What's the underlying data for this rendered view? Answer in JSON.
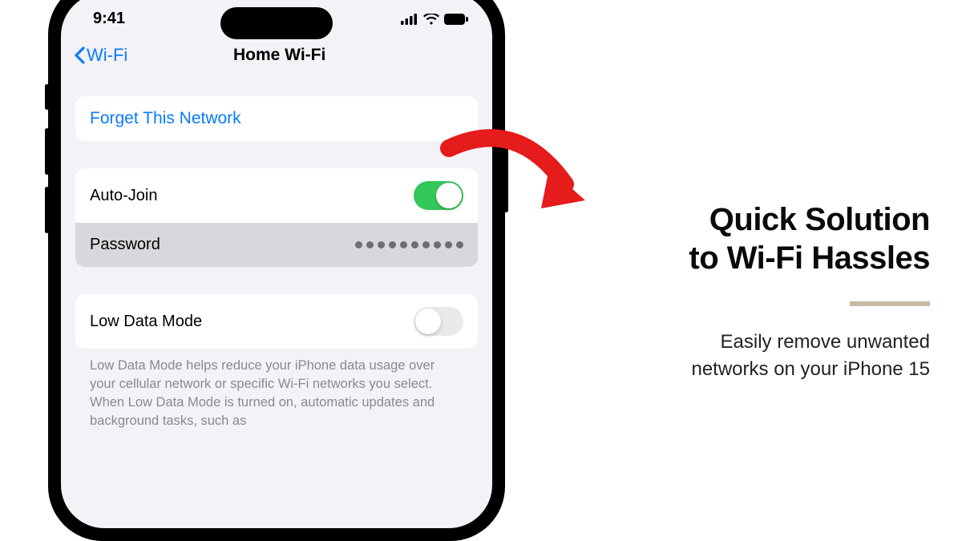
{
  "statusbar": {
    "time": "9:41"
  },
  "nav": {
    "back": "Wi-Fi",
    "title": "Home Wi-Fi"
  },
  "forget": {
    "label": "Forget This Network"
  },
  "autojoin": {
    "label": "Auto-Join",
    "on": true
  },
  "password": {
    "label": "Password"
  },
  "lowdata": {
    "label": "Low Data Mode",
    "on": false,
    "help": "Low Data Mode helps reduce your iPhone data usage over your cellular network or specific Wi-Fi networks you select. When Low Data Mode is turned on, automatic updates and background tasks, such as"
  },
  "promo": {
    "headline1": "Quick Solution",
    "headline2": "to Wi-Fi Hassles",
    "sub1": "Easily remove unwanted",
    "sub2": "networks on your iPhone 15"
  },
  "colors": {
    "accent": "#0a7aff",
    "toggle_on": "#34c759",
    "arrow": "#e61b1b"
  }
}
